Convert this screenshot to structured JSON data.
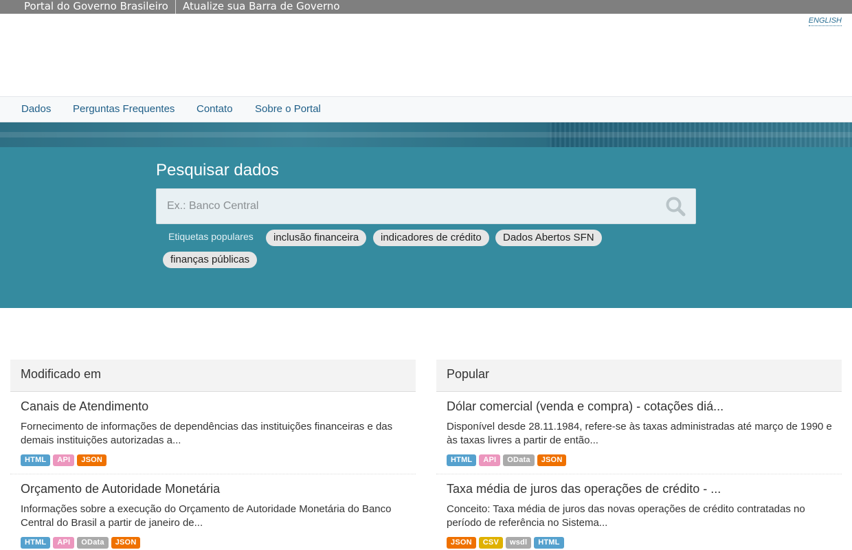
{
  "govbar": {
    "portal_label": "Portal do Governo Brasileiro",
    "update_label": "Atualize sua Barra de Governo"
  },
  "language_link": "ENGLISH",
  "nav": {
    "items": [
      "Dados",
      "Perguntas Frequentes",
      "Contato",
      "Sobre o Portal"
    ]
  },
  "search": {
    "title": "Pesquisar dados",
    "placeholder": "Ex.: Banco Central",
    "popular_tags_label": "Etiquetas populares",
    "tags": [
      "inclusão financeira",
      "indicadores de crédito",
      "Dados Abertos SFN",
      "finanças públicas"
    ]
  },
  "modified": {
    "heading": "Modificado em",
    "items": [
      {
        "title": "Canais de Atendimento",
        "description": "Fornecimento de informações de dependências das instituições financeiras e das demais instituições autorizadas a...",
        "formats": [
          "HTML",
          "API",
          "JSON"
        ]
      },
      {
        "title": "Orçamento de Autoridade Monetária",
        "description": "Informações sobre a execução do Orçamento de Autoridade Monetária do Banco Central do Brasil a partir de janeiro de...",
        "formats": [
          "HTML",
          "API",
          "OData",
          "JSON"
        ]
      }
    ]
  },
  "popular": {
    "heading": "Popular",
    "items": [
      {
        "title": "Dólar comercial (venda e compra) - cotações diá...",
        "description": "Disponível desde 28.11.1984, refere-se às taxas administradas até março de 1990 e às taxas livres a partir de então...",
        "formats": [
          "HTML",
          "API",
          "OData",
          "JSON"
        ]
      },
      {
        "title": "Taxa média de juros das operações de crédito - ...",
        "description": "Conceito: Taxa média de juros das novas operações de crédito contratadas no período de referência no Sistema...",
        "formats": [
          "JSON",
          "CSV",
          "wsdl",
          "HTML"
        ]
      }
    ]
  },
  "format_colors": {
    "HTML": "#55a1ce",
    "API": "#ec96be",
    "JSON": "#ef7100",
    "OData": "#aaaaaa",
    "CSV": "#dfb100",
    "wsdl": "#aaaaaa"
  },
  "colors": {
    "govbar": "#7f7f7f",
    "search_section": "#358b9f",
    "nav_link": "#1f5f88"
  }
}
